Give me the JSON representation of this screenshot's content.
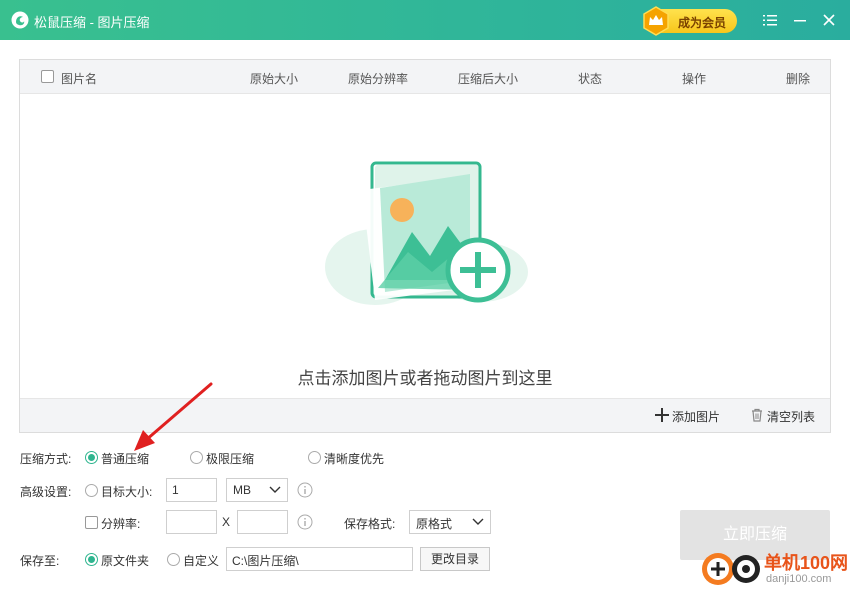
{
  "titlebar": {
    "title": "松鼠压缩 - 图片压缩",
    "vip_label": "成为会员",
    "menu_icon": "menu-icon",
    "minimize_icon": "minimize-icon",
    "close_icon": "close-icon"
  },
  "table": {
    "columns": [
      "图片名",
      "原始大小",
      "原始分辨率",
      "压缩后大小",
      "状态",
      "操作",
      "删除"
    ],
    "drop_hint": "点击添加图片或者拖动图片到这里",
    "add_label": "添加图片",
    "clear_label": "清空列表"
  },
  "options": {
    "mode_label": "压缩方式:",
    "mode_normal": "普通压缩",
    "mode_extreme": "极限压缩",
    "mode_clarity": "清晰度优先",
    "advanced_label": "高级设置:",
    "target_size_label": "目标大小:",
    "target_size_value": "1",
    "target_unit": "MB",
    "resolution_label": "分辨率:",
    "resolution_x": "X",
    "save_format_label": "保存格式:",
    "save_format_value": "原格式",
    "save_to_label": "保存至:",
    "save_original": "原文件夹",
    "save_custom": "自定义",
    "save_path": "C:\\图片压缩\\",
    "change_dir": "更改目录",
    "start_label": "立即压缩"
  },
  "colors": {
    "accent": "#2fb58f",
    "titlebar": "#39c08f",
    "vip": "#f7c61b",
    "annotation_arrow": "#e02020"
  },
  "watermark": {
    "line1": "单机100网",
    "line2": "danji100.com"
  }
}
